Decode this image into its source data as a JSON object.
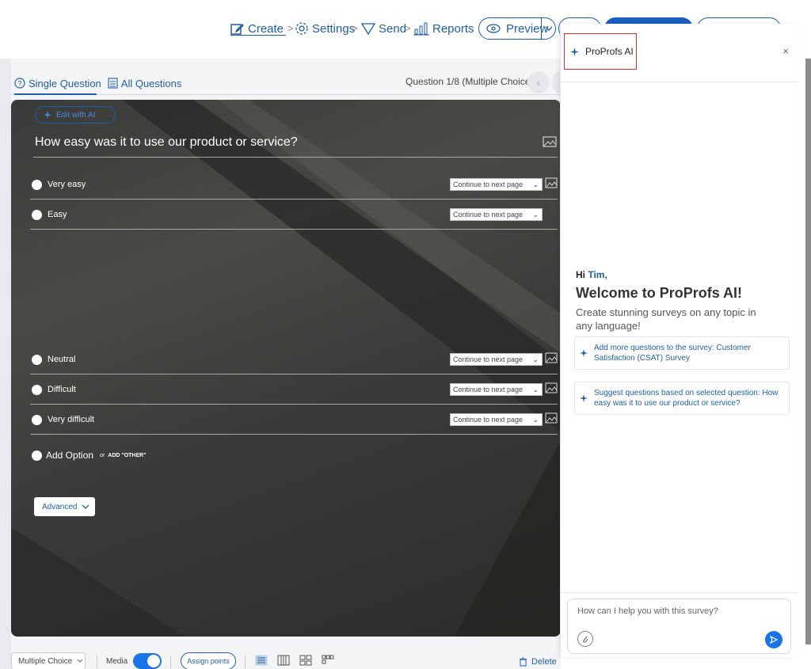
{
  "nav": {
    "create": "Create",
    "settings": "Settings",
    "send": "Send",
    "reports": "Reports",
    "preview": "Preview",
    "separator": ">"
  },
  "tabs": {
    "single": "Single Question",
    "all": "All Questions",
    "counter": "Question 1/8 (Multiple Choice)"
  },
  "question": {
    "edit_ai": "Edit with AI",
    "title": "How easy was it to use our product or service?",
    "options": [
      {
        "label": "Very easy",
        "branch": "Continue to next page"
      },
      {
        "label": "Easy",
        "branch": "Continue to next page"
      },
      {
        "label": "Neutral",
        "branch": "Continue to next page"
      },
      {
        "label": "Difficult",
        "branch": "Continue to next page"
      },
      {
        "label": "Very difficult",
        "branch": "Continue to next page"
      }
    ],
    "add_option": "Add Option",
    "or": "or",
    "add_other": "ADD \"OTHER\"",
    "advanced": "Advanced"
  },
  "bottom": {
    "qtype": "Multiple Choice",
    "media": "Media",
    "media_on": true,
    "assign_points": "Assign points",
    "delete": "Delete"
  },
  "ai": {
    "title": "ProProfs AI",
    "close": "×",
    "hi": "Hi",
    "name": "Tim,",
    "welcome": "Welcome to ProProfs AI!",
    "subtitle": "Create stunning surveys on any topic in any language!",
    "suggestions": [
      "Add more questions to the survey: Customer Satisfaction (CSAT) Survey",
      "Suggest questions based on selected question: How easy was it to use our product or service?"
    ],
    "input_placeholder": "How can I help you with this survey?"
  },
  "colors": {
    "accent": "#1f5fa8",
    "toggle": "#1a73e8",
    "highlight_border": "#d93025"
  }
}
